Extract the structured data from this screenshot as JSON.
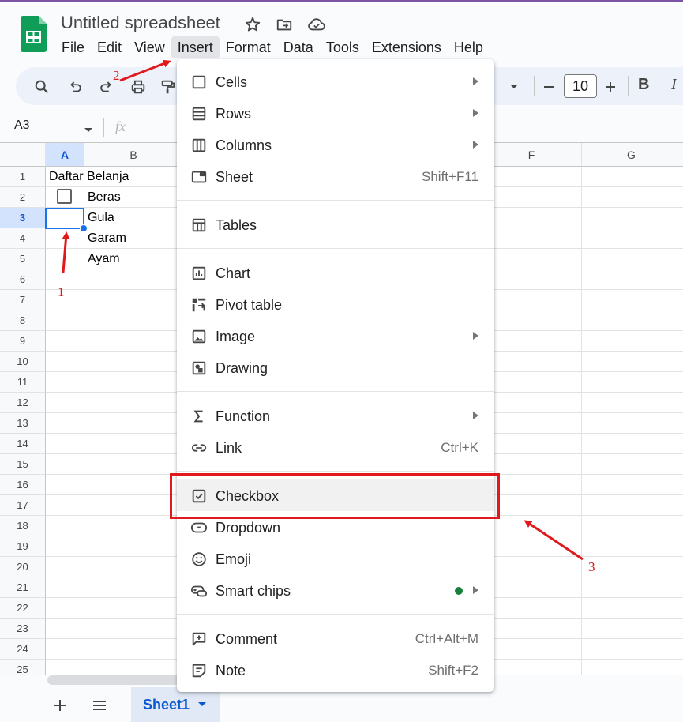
{
  "app": {
    "title": "Untitled spreadsheet",
    "menu": [
      "File",
      "Edit",
      "View",
      "Insert",
      "Format",
      "Data",
      "Tools",
      "Extensions",
      "Help"
    ],
    "active_menu": "Insert"
  },
  "toolbar": {
    "font_size": "10",
    "bold_label": "B",
    "italic_label": "I"
  },
  "formula_bar": {
    "name_box": "A3",
    "fx_label": "fx"
  },
  "grid": {
    "columns": [
      "A",
      "B",
      "F",
      "G"
    ],
    "selected_column": "A",
    "rows": [
      "1",
      "2",
      "3",
      "4",
      "5",
      "6",
      "7",
      "8",
      "9",
      "10",
      "11",
      "12",
      "13",
      "14",
      "15",
      "16",
      "17",
      "18",
      "19",
      "20",
      "21",
      "22",
      "23",
      "24",
      "25"
    ],
    "selected_row": "3",
    "cells": {
      "A1": "Daftar Belanja",
      "B2": "Beras",
      "B3": "Gula",
      "B4": "Garam",
      "B5": "Ayam"
    }
  },
  "insert_menu": {
    "items": [
      {
        "label": "Cells",
        "icon": "cells-icon",
        "submenu": true
      },
      {
        "label": "Rows",
        "icon": "rows-icon",
        "submenu": true
      },
      {
        "label": "Columns",
        "icon": "columns-icon",
        "submenu": true
      },
      {
        "label": "Sheet",
        "icon": "sheet-icon",
        "shortcut": "Shift+F11"
      },
      {
        "label": "Tables",
        "icon": "tables-icon"
      },
      {
        "label": "Chart",
        "icon": "chart-icon"
      },
      {
        "label": "Pivot table",
        "icon": "pivot-table-icon"
      },
      {
        "label": "Image",
        "icon": "image-icon",
        "submenu": true
      },
      {
        "label": "Drawing",
        "icon": "drawing-icon"
      },
      {
        "label": "Function",
        "icon": "sigma-icon",
        "submenu": true
      },
      {
        "label": "Link",
        "icon": "link-icon",
        "shortcut": "Ctrl+K"
      },
      {
        "label": "Checkbox",
        "icon": "checkbox-icon",
        "highlighted": true
      },
      {
        "label": "Dropdown",
        "icon": "dropdown-icon"
      },
      {
        "label": "Emoji",
        "icon": "emoji-icon"
      },
      {
        "label": "Smart chips",
        "icon": "smart-chips-icon",
        "submenu": true,
        "new_dot": true
      },
      {
        "label": "Comment",
        "icon": "comment-icon",
        "shortcut": "Ctrl+Alt+M"
      },
      {
        "label": "Note",
        "icon": "note-icon",
        "shortcut": "Shift+F2"
      }
    ]
  },
  "sheets": {
    "active": "Sheet1"
  },
  "annotations": {
    "step1": "1",
    "step2": "2",
    "step3": "3",
    "color": "#e0191d"
  }
}
